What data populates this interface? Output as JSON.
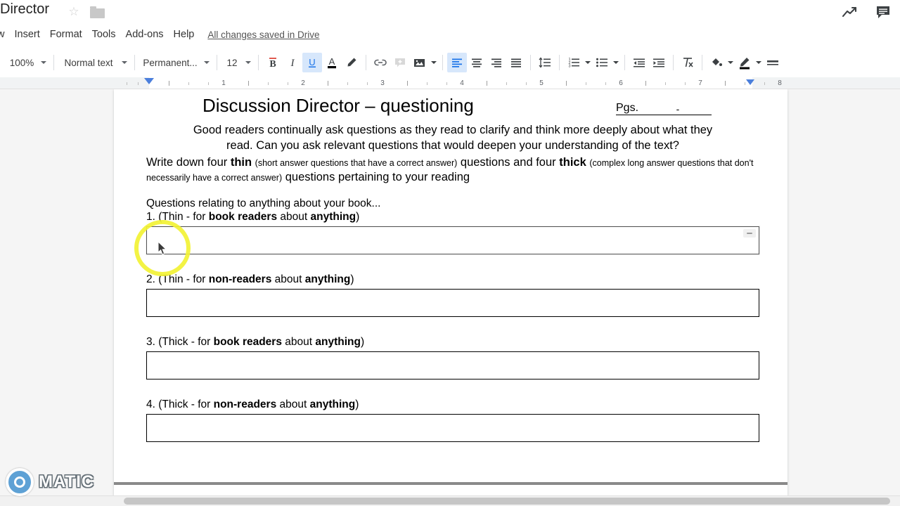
{
  "titlebar": {
    "doc_title": "Director",
    "star_icon": "star-icon",
    "folder_icon": "folder-icon",
    "trending_icon": "trending-icon",
    "comments_icon": "comments-icon"
  },
  "menubar": {
    "items": [
      {
        "label": "w"
      },
      {
        "label": "Insert"
      },
      {
        "label": "Format"
      },
      {
        "label": "Tools"
      },
      {
        "label": "Add-ons"
      },
      {
        "label": "Help"
      }
    ],
    "save_status": "All changes saved in Drive"
  },
  "toolbar": {
    "zoom": "100%",
    "paragraph_style": "Normal text",
    "font": "Permanent...",
    "font_size": "12",
    "buttons": [
      {
        "name": "bold-button",
        "glyph": "B",
        "active": false
      },
      {
        "name": "italic-button",
        "glyph": "I",
        "active": false
      },
      {
        "name": "underline-button",
        "glyph": "U",
        "active": true
      },
      {
        "name": "text-color-button",
        "glyph": "A",
        "active": false
      },
      {
        "name": "highlight-color-button",
        "glyph": "pen",
        "active": false
      },
      {
        "name": "insert-link-button",
        "glyph": "link",
        "active": false
      },
      {
        "name": "add-comment-button",
        "glyph": "comment",
        "active": false
      },
      {
        "name": "insert-image-button",
        "glyph": "image",
        "active": false
      },
      {
        "name": "align-left-button",
        "glyph": "align-left",
        "active": true
      },
      {
        "name": "align-center-button",
        "glyph": "align-center",
        "active": false
      },
      {
        "name": "align-right-button",
        "glyph": "align-right",
        "active": false
      },
      {
        "name": "align-justify-button",
        "glyph": "align-justify",
        "active": false
      },
      {
        "name": "line-spacing-button",
        "glyph": "line-spacing",
        "active": false
      },
      {
        "name": "numbered-list-button",
        "glyph": "numbered-list",
        "active": false
      },
      {
        "name": "bulleted-list-button",
        "glyph": "bulleted-list",
        "active": false
      },
      {
        "name": "decrease-indent-button",
        "glyph": "outdent",
        "active": false
      },
      {
        "name": "increase-indent-button",
        "glyph": "indent",
        "active": false
      },
      {
        "name": "clear-formatting-button",
        "glyph": "clear-format",
        "active": false
      },
      {
        "name": "fill-color-button",
        "glyph": "paint-bucket",
        "active": false
      },
      {
        "name": "border-color-button",
        "glyph": "pencil",
        "active": false
      },
      {
        "name": "border-weight-button",
        "glyph": "lines",
        "active": false
      }
    ]
  },
  "ruler": {
    "tick_numbers": [
      "1",
      "2",
      "3",
      "4",
      "5",
      "6",
      "7",
      "8"
    ],
    "left_indent_marker": "left-indent-marker",
    "right_indent_marker": "right-indent-marker"
  },
  "document": {
    "heading": "Discussion Director – questioning",
    "pgs_label": "Pgs.",
    "pgs_value": "-",
    "intro_line1": "Good readers continually ask questions as they read to clarify and think more deeply about what they",
    "intro_line2": "read.  Can you ask relevant questions that would deepen your understanding of the text?",
    "instr_a": "Write down four ",
    "instr_thin": "thin",
    "instr_thin_paren": "(short answer questions that have a correct answer)",
    "instr_b": " questions and four ",
    "instr_thick": "thick",
    "instr_thick_paren": "(complex long answer questions that don't necessarily have a correct answer)",
    "instr_c": " questions pertaining to your reading",
    "questions_lead": "Questions relating to anything about your book...",
    "questions": [
      {
        "number": "1.",
        "open_paren": " (Thin - for ",
        "who": "book readers",
        "mid": " about ",
        "topic": "anything",
        "close_paren": ")",
        "answer": "",
        "selected": true
      },
      {
        "number": "2.",
        "open_paren": " (Thin - for ",
        "who": "non-readers",
        "mid": " about ",
        "topic": "anything",
        "close_paren": ")",
        "answer": "",
        "selected": false
      },
      {
        "number": "3.",
        "open_paren": " (Thick - for ",
        "who": "book readers",
        "mid": " about ",
        "topic": "anything",
        "close_paren": ")",
        "answer": "",
        "selected": false
      },
      {
        "number": "4.",
        "open_paren": " (Thick - for ",
        "who": "non-readers",
        "mid": " about ",
        "topic": "anything",
        "close_paren": ")",
        "answer": "",
        "selected": false
      }
    ]
  },
  "watermark": {
    "text": "MATIC",
    "ring_color": "#5a9fd4"
  },
  "colors": {
    "accent": "#4b7fdc",
    "toolbar_active_bg": "#d7e7fb",
    "cursor_ring": "#f2f234",
    "page_bg": "#ffffff",
    "canvas_bg": "#f5f5f5"
  }
}
